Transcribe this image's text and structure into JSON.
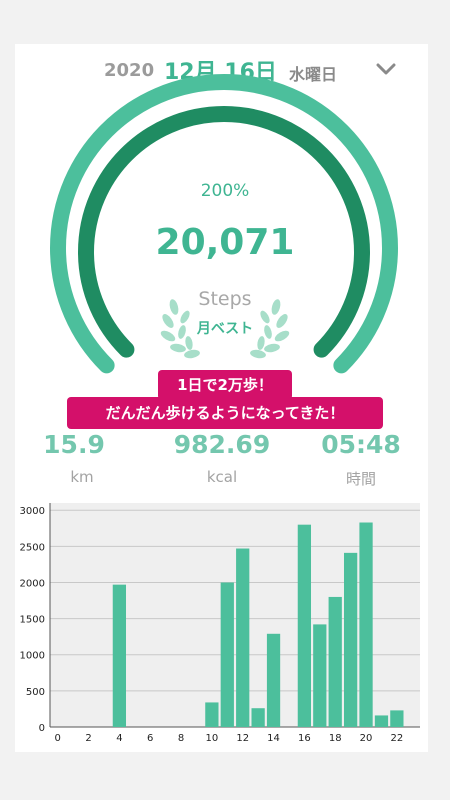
{
  "header": {
    "year": "2020",
    "month_day": "12月 16日",
    "weekday": "水曜日"
  },
  "progress": {
    "percent_label": "200%",
    "percent": 200,
    "steps": "20,071",
    "steps_label": "Steps",
    "badge": "月ベスト"
  },
  "message": {
    "line1": "1日で2万歩！",
    "line2": "だんだん歩けるようになってきた！"
  },
  "stats": [
    {
      "value": "15.9",
      "unit": "km"
    },
    {
      "value": "982.69",
      "unit": "kcal"
    },
    {
      "value": "05:48",
      "unit": "時間"
    }
  ],
  "colors": {
    "accent": "#3fb592",
    "outer_ring": "#4cbf9c",
    "inner_ring": "#1f8c62",
    "bar": "#4cbf9c",
    "banner": "#d4106a",
    "chart_bg": "#efefef"
  },
  "icons": {
    "dropdown": "chevron-down-icon",
    "badge": "laurel-wreath-icon"
  },
  "chart_data": {
    "type": "bar",
    "x": [
      4,
      10,
      11,
      12,
      13,
      14,
      16,
      17,
      18,
      19,
      20,
      21,
      22
    ],
    "values": [
      1970,
      340,
      2000,
      2470,
      260,
      1290,
      2800,
      1420,
      1800,
      2410,
      2830,
      160,
      230
    ],
    "xticks": [
      0,
      2,
      4,
      6,
      8,
      10,
      12,
      14,
      16,
      18,
      20,
      22
    ],
    "yticks": [
      0,
      500,
      1000,
      1500,
      2000,
      2500,
      3000
    ],
    "xlim": [
      -0.5,
      23.5
    ],
    "ylim": [
      0,
      3100
    ],
    "grid": true,
    "xlabel": "",
    "ylabel": ""
  }
}
